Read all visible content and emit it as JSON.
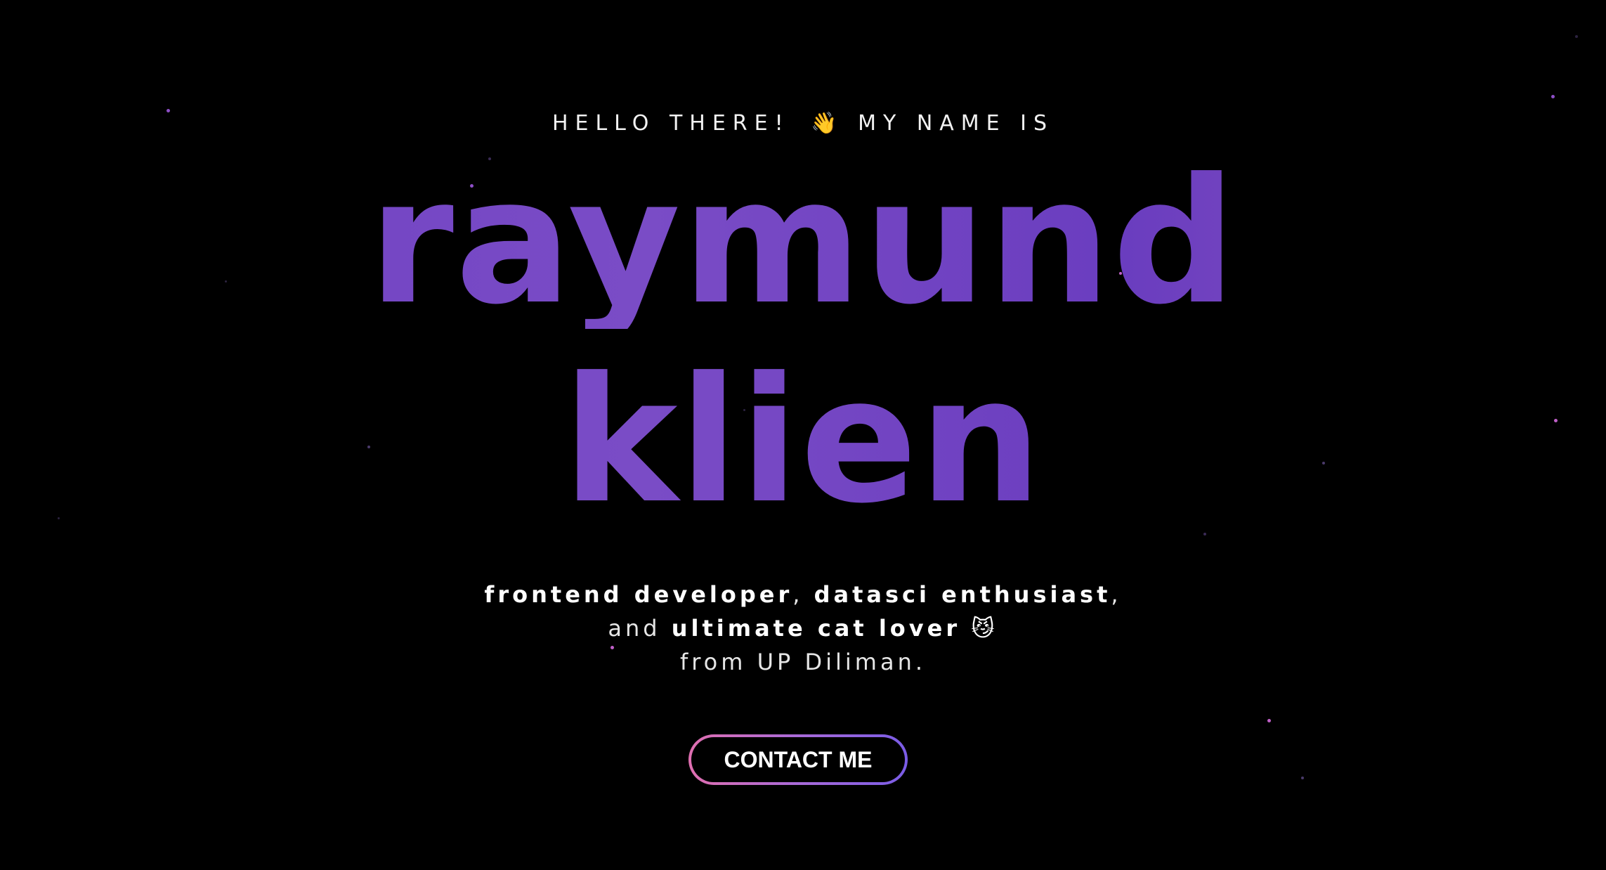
{
  "hero": {
    "greeting_left": "HELLO THERE!",
    "greeting_emoji": "👋",
    "greeting_right": "MY NAME IS",
    "name_first": "raymund",
    "name_last": "klien",
    "tagline_line1_role1": "frontend developer",
    "tagline_line1_sep": ", ",
    "tagline_line1_role2": "datasci enthusiast",
    "tagline_line1_end": ",",
    "tagline_line2_prefix": "and ",
    "tagline_line2_bold": "ultimate cat lover",
    "tagline_line2_emoji": "😼",
    "tagline_line3": "from UP Diliman.",
    "contact_label": "CONTACT ME"
  },
  "colors": {
    "background": "#000000",
    "name_gradient_start": "#6d3fc2",
    "name_gradient_end": "#8a55c0",
    "button_gradient_start": "#e06fb0",
    "button_gradient_end": "#7a5ce6",
    "star_color": "#a05ad8"
  }
}
